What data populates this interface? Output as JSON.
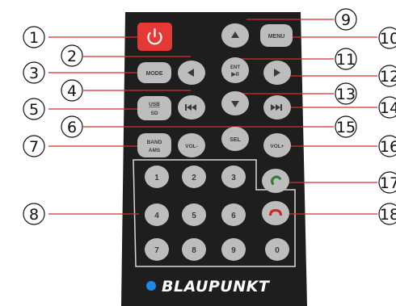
{
  "brand": {
    "name": "BLAUPUNKT",
    "dot_color": "#1e88e5"
  },
  "colors": {
    "remote_body": "#1e1e1e",
    "button": "#bdbdbd",
    "power": "#e53935",
    "callout_line": "#d32f2f",
    "call_green": "#2e7d32",
    "call_red": "#c62828"
  },
  "buttons": {
    "power": {
      "icon": "power-icon"
    },
    "up": {
      "icon": "arrow-up-icon"
    },
    "menu": {
      "label": "MENU"
    },
    "mode": {
      "label": "MODE"
    },
    "left": {
      "icon": "arrow-left-icon"
    },
    "ent": {
      "label1": "ENT",
      "label2": "▶II"
    },
    "right": {
      "icon": "arrow-right-icon"
    },
    "usb": {
      "label1": "USB",
      "label2": "SD"
    },
    "prev": {
      "icon": "prev-track-icon"
    },
    "down": {
      "icon": "arrow-down-icon"
    },
    "next": {
      "icon": "next-track-icon"
    },
    "band": {
      "label1": "BAND",
      "label2": "AMS"
    },
    "vol_minus": {
      "label": "VOL-"
    },
    "sel": {
      "label": "SEL"
    },
    "vol_plus": {
      "label": "VOL+"
    },
    "keypad": [
      "1",
      "2",
      "3",
      "4",
      "5",
      "6",
      "7",
      "8",
      "9",
      "0"
    ],
    "call_answer": {
      "icon": "call-answer-icon"
    },
    "call_end": {
      "icon": "call-end-icon"
    }
  },
  "callouts": [
    "1",
    "2",
    "3",
    "4",
    "5",
    "6",
    "7",
    "8",
    "9",
    "10",
    "11",
    "12",
    "13",
    "14",
    "15",
    "16",
    "17",
    "18"
  ]
}
